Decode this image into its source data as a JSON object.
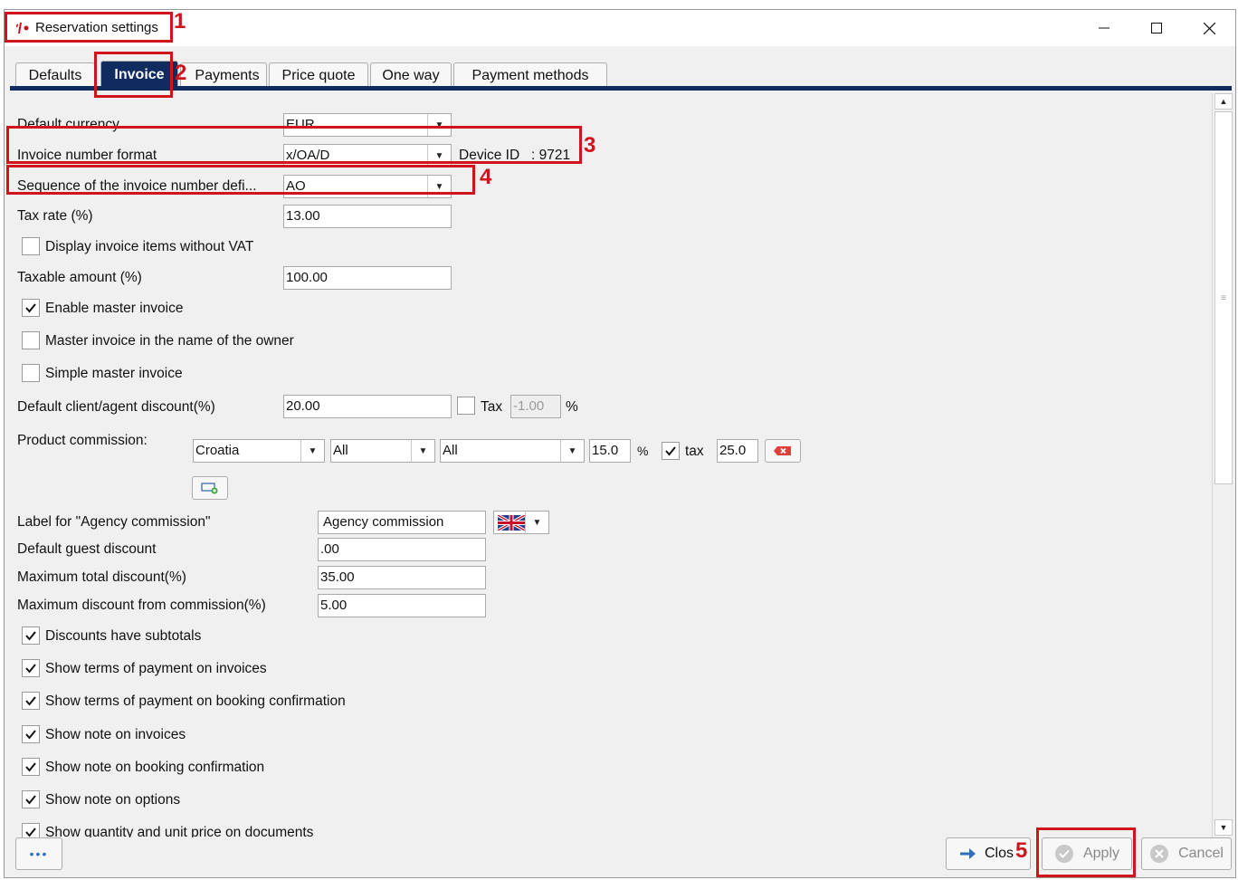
{
  "window": {
    "title": "Reservation settings",
    "controls": [
      "minimize",
      "maximize",
      "close"
    ]
  },
  "tabs": [
    {
      "label": "Defaults",
      "active": false
    },
    {
      "label": "Invoice",
      "active": true
    },
    {
      "label": "Payments",
      "active": false
    },
    {
      "label": "Price quote",
      "active": false
    },
    {
      "label": "One way",
      "active": false
    },
    {
      "label": "Payment methods",
      "active": false
    }
  ],
  "form": {
    "default_currency": {
      "label": "Default currency",
      "value": "EUR"
    },
    "invoice_number_format": {
      "label": "Invoice number format",
      "value": "x/OA/D"
    },
    "device_id": {
      "label": "Device ID",
      "value": ": 9721"
    },
    "sequence": {
      "label": "Sequence of the invoice number defi...",
      "value": "AO"
    },
    "tax_rate": {
      "label": "Tax rate  (%)",
      "value": "13.00"
    },
    "display_without_vat": {
      "label": "Display invoice items without VAT",
      "checked": false
    },
    "taxable_amount": {
      "label": "Taxable amount (%)",
      "value": "100.00"
    },
    "enable_master_invoice": {
      "label": "Enable master invoice",
      "checked": true
    },
    "master_invoice_owner": {
      "label": "Master invoice in the name of the owner",
      "checked": false
    },
    "simple_master_invoice": {
      "label": "Simple master invoice",
      "checked": false
    },
    "default_client_discount": {
      "label": "Default client/agent discount(%)",
      "value": "20.00",
      "tax_label": "Tax",
      "tax_checked": false,
      "tax_value": "-1.00",
      "percent": "%"
    },
    "product_commission": {
      "label": "Product commission:",
      "country": "Croatia",
      "filter1": "All",
      "filter2": "All",
      "rate": "15.0",
      "percent": "%",
      "tax_label": "tax",
      "tax_checked": true,
      "tax_value": "25.0"
    },
    "agency_commission_label": {
      "label": "Label for \"Agency commission\"",
      "value": "Agency commission",
      "language": "English (UK)"
    },
    "default_guest_discount": {
      "label": "Default guest discount",
      "value": ".00"
    },
    "max_total_discount": {
      "label": "Maximum total discount(%)",
      "value": "35.00"
    },
    "max_discount_commission": {
      "label": "Maximum discount from commission(%)",
      "value": "5.00"
    },
    "checkboxes": [
      {
        "label": "Discounts have subtotals",
        "checked": true
      },
      {
        "label": "Show terms of payment on invoices",
        "checked": true
      },
      {
        "label": "Show terms of payment on booking confirmation",
        "checked": true
      },
      {
        "label": "Show note on invoices",
        "checked": true
      },
      {
        "label": "Show note on booking confirmation",
        "checked": true
      },
      {
        "label": "Show note on options",
        "checked": true
      },
      {
        "label": "Show quantity and unit price on documents",
        "checked": true
      }
    ]
  },
  "footer": {
    "more_label": "•••",
    "close_label": "Clos",
    "apply_label": "Apply",
    "cancel_label": "Cancel"
  },
  "annotations": [
    "1",
    "2",
    "3",
    "4",
    "5"
  ],
  "colors": {
    "tab_active_bg": "#0f2b60",
    "annotation": "#d0141b",
    "window_bg": "#f0f0f0"
  }
}
